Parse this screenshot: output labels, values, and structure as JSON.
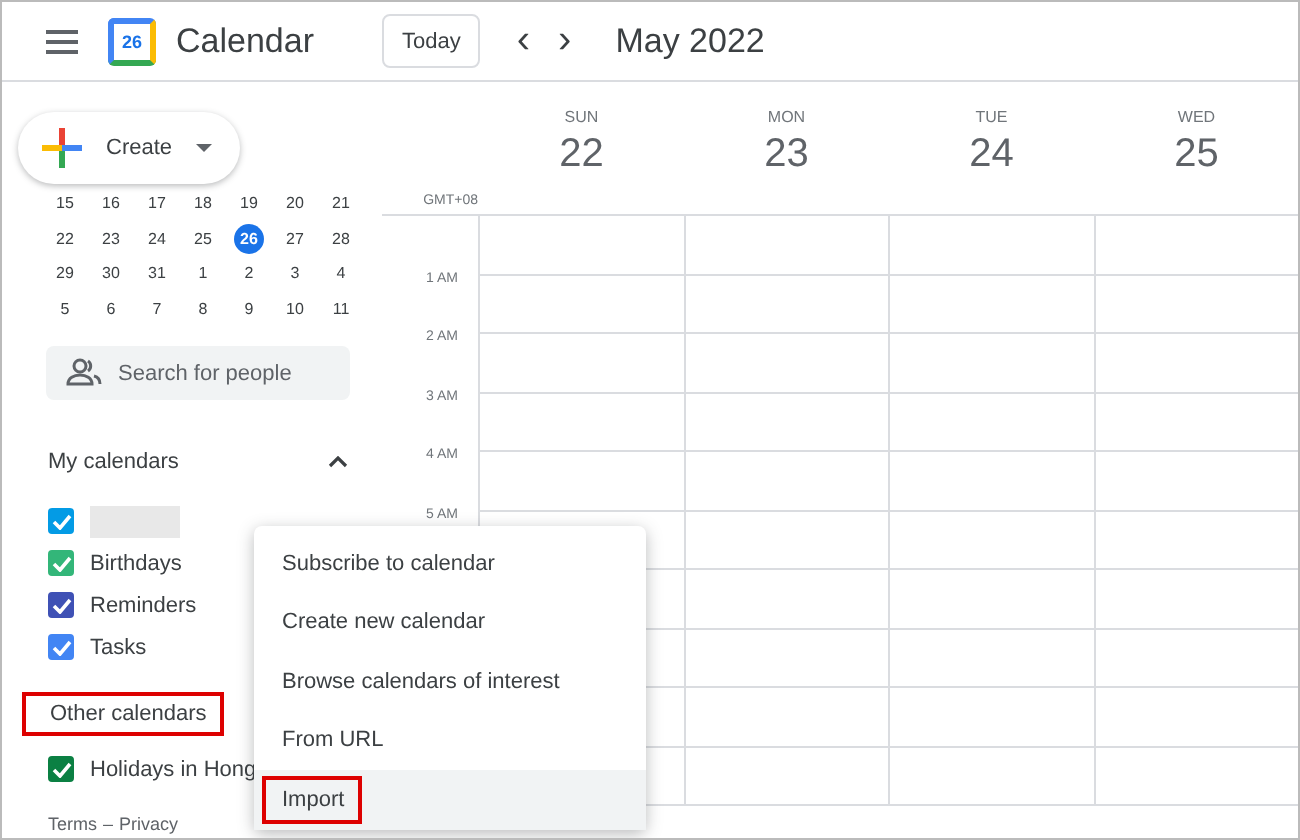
{
  "header": {
    "app_name": "Calendar",
    "logo_day": "26",
    "today_button": "Today",
    "prev": "‹",
    "next": "›",
    "title": "May 2022"
  },
  "create_button": {
    "label": "Create"
  },
  "mini_calendar": {
    "weeks": [
      [
        {
          "day": "15",
          "selected": false
        },
        {
          "day": "16",
          "selected": false
        },
        {
          "day": "17",
          "selected": false
        },
        {
          "day": "18",
          "selected": false
        },
        {
          "day": "19",
          "selected": false
        },
        {
          "day": "20",
          "selected": false
        },
        {
          "day": "21",
          "selected": false
        }
      ],
      [
        {
          "day": "22",
          "selected": false
        },
        {
          "day": "23",
          "selected": false
        },
        {
          "day": "24",
          "selected": false
        },
        {
          "day": "25",
          "selected": false
        },
        {
          "day": "26",
          "selected": true
        },
        {
          "day": "27",
          "selected": false
        },
        {
          "day": "28",
          "selected": false
        }
      ],
      [
        {
          "day": "29",
          "selected": false
        },
        {
          "day": "30",
          "selected": false
        },
        {
          "day": "31",
          "selected": false
        },
        {
          "day": "1",
          "selected": false
        },
        {
          "day": "2",
          "selected": false
        },
        {
          "day": "3",
          "selected": false
        },
        {
          "day": "4",
          "selected": false
        }
      ],
      [
        {
          "day": "5",
          "selected": false
        },
        {
          "day": "6",
          "selected": false
        },
        {
          "day": "7",
          "selected": false
        },
        {
          "day": "8",
          "selected": false
        },
        {
          "day": "9",
          "selected": false
        },
        {
          "day": "10",
          "selected": false
        },
        {
          "day": "11",
          "selected": false
        }
      ]
    ]
  },
  "search": {
    "placeholder": "Search for people"
  },
  "my_calendars": {
    "title": "My calendars",
    "expanded": true,
    "items": [
      {
        "kind": "redacted",
        "color": "#039be5",
        "checked": true
      },
      {
        "kind": "named",
        "label": "Birthdays",
        "color": "#33b679",
        "checked": true
      },
      {
        "kind": "named",
        "label": "Reminders",
        "color": "#3f51b5",
        "checked": true
      },
      {
        "kind": "named",
        "label": "Tasks",
        "color": "#4285f4",
        "checked": true
      }
    ]
  },
  "other_calendars": {
    "title": "Other calendars",
    "highlighted": true,
    "items": [
      {
        "kind": "named",
        "label": "Holidays in Hong",
        "color": "#0b8043",
        "checked": true
      }
    ]
  },
  "footer": {
    "terms": "Terms",
    "separator": "–",
    "privacy": "Privacy"
  },
  "timezone": "GMT+08",
  "days": [
    {
      "name": "SUN",
      "date": "22"
    },
    {
      "name": "MON",
      "date": "23"
    },
    {
      "name": "TUE",
      "date": "24"
    },
    {
      "name": "WED",
      "date": "25"
    }
  ],
  "hours": [
    "1 AM",
    "2 AM",
    "3 AM",
    "4 AM",
    "5 AM"
  ],
  "menu": {
    "items": [
      {
        "label": "Subscribe to calendar",
        "hovered": false,
        "highlighted": false
      },
      {
        "label": "Create new calendar",
        "hovered": false,
        "highlighted": false
      },
      {
        "label": "Browse calendars of interest",
        "hovered": false,
        "highlighted": false
      },
      {
        "label": "From URL",
        "hovered": false,
        "highlighted": false
      },
      {
        "label": "Import",
        "hovered": true,
        "highlighted": true
      }
    ]
  }
}
